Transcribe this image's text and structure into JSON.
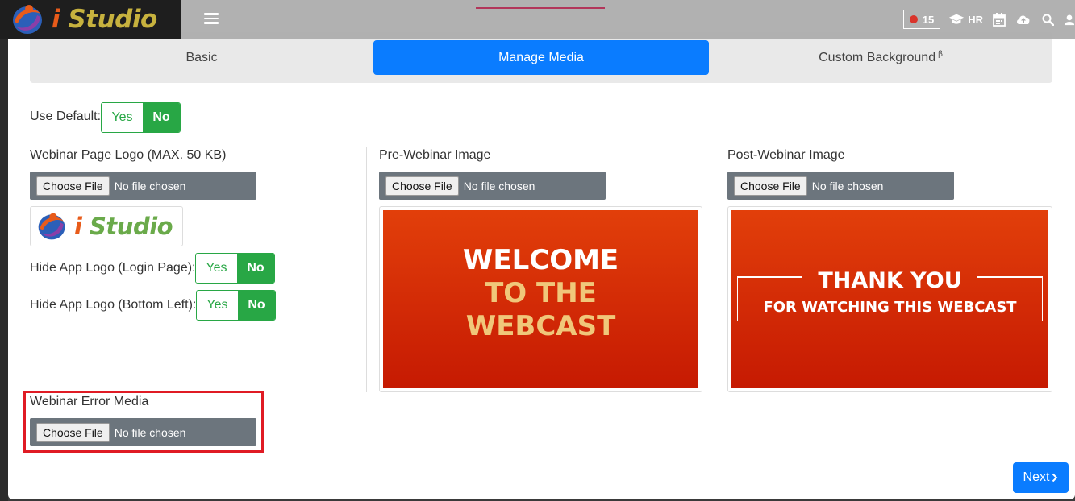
{
  "app": {
    "brand_i": "i",
    "brand_rest": " Studio",
    "live_count": "15",
    "hr_label": "HR"
  },
  "tabs": [
    {
      "label": "Basic"
    },
    {
      "label": "Manage Media"
    },
    {
      "label": "Custom Background",
      "sup": "β"
    }
  ],
  "use_default": {
    "label": "Use Default:",
    "yes": "Yes",
    "no": "No"
  },
  "logo_section": {
    "label": "Webinar Page Logo (MAX. 50 KB)",
    "choose": "Choose File",
    "status": "No file chosen"
  },
  "hide_login": {
    "label": "Hide App Logo (Login Page):",
    "yes": "Yes",
    "no": "No"
  },
  "hide_bottom": {
    "label": "Hide App Logo (Bottom Left):",
    "yes": "Yes",
    "no": "No"
  },
  "pre_webinar": {
    "label": "Pre-Webinar Image",
    "choose": "Choose File",
    "status": "No file chosen",
    "line1": "WELCOME",
    "line2": "TO THE",
    "line3": "WEBCAST"
  },
  "post_webinar": {
    "label": "Post-Webinar Image",
    "choose": "Choose File",
    "status": "No file chosen",
    "line1": "THANK YOU",
    "line2": "FOR WATCHING THIS WEBCAST"
  },
  "error_media": {
    "label": "Webinar Error Media",
    "choose": "Choose File",
    "status": "No file chosen"
  },
  "next": {
    "label": "Next"
  },
  "colors": {
    "primary": "#0a7cff",
    "success": "#28a745",
    "highlight": "#e01b24"
  }
}
